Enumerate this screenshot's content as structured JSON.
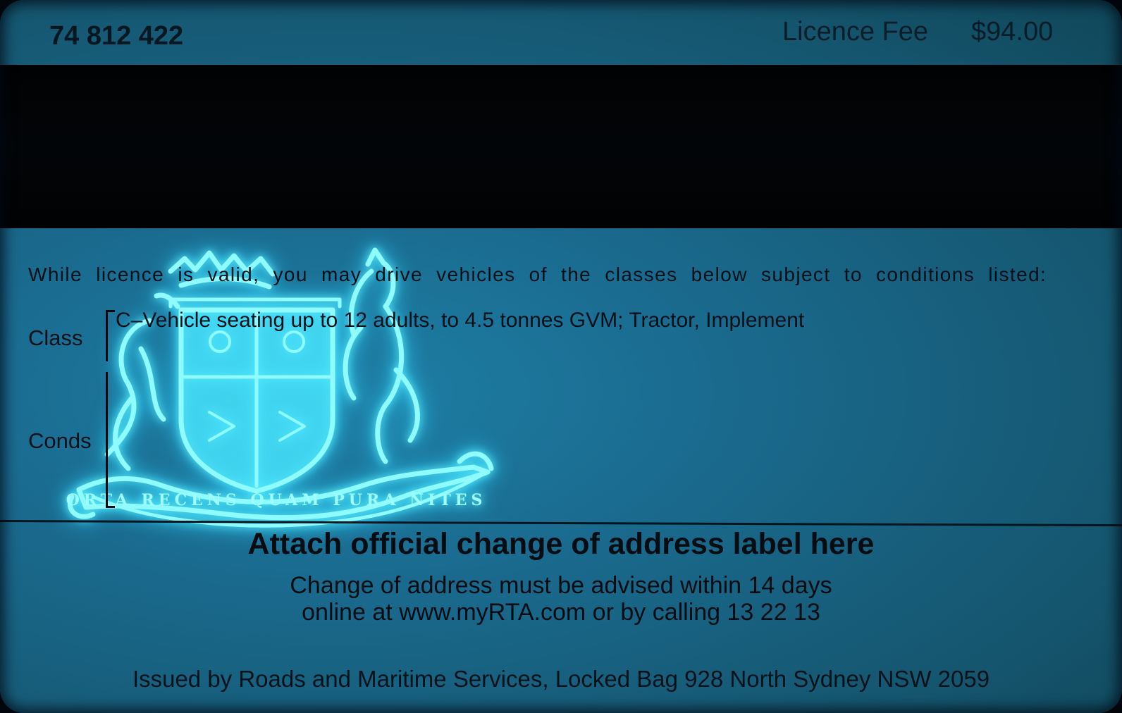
{
  "card": {
    "number": "74 812 422",
    "licence_fee_label": "Licence Fee",
    "licence_fee_value": "$94.00",
    "validity_statement": "While licence is valid, you may drive vehicles of the classes below subject to conditions listed:",
    "class_label": "Class",
    "class_value": "C–Vehicle seating up to 12 adults, to 4.5 tonnes GVM; Tractor, Implement",
    "conds_label": "Conds",
    "address_label_title": "Attach official change of address label here",
    "address_notice_line1": "Change of address must be advised within 14 days",
    "address_notice_line2": "online at www.myRTA.com or by calling 13 22 13",
    "issuer": "Issued by Roads and Maritime Services, Locked Bag 928 North Sydney NSW 2059"
  },
  "hologram": {
    "name": "coat-of-arms-icon",
    "motto": "ORTA RECENS QUAM PURA NITES",
    "glow_color": "#6ff6ff"
  },
  "colors": {
    "card_tint": "#1a6a8e",
    "stripe": "#020508"
  }
}
